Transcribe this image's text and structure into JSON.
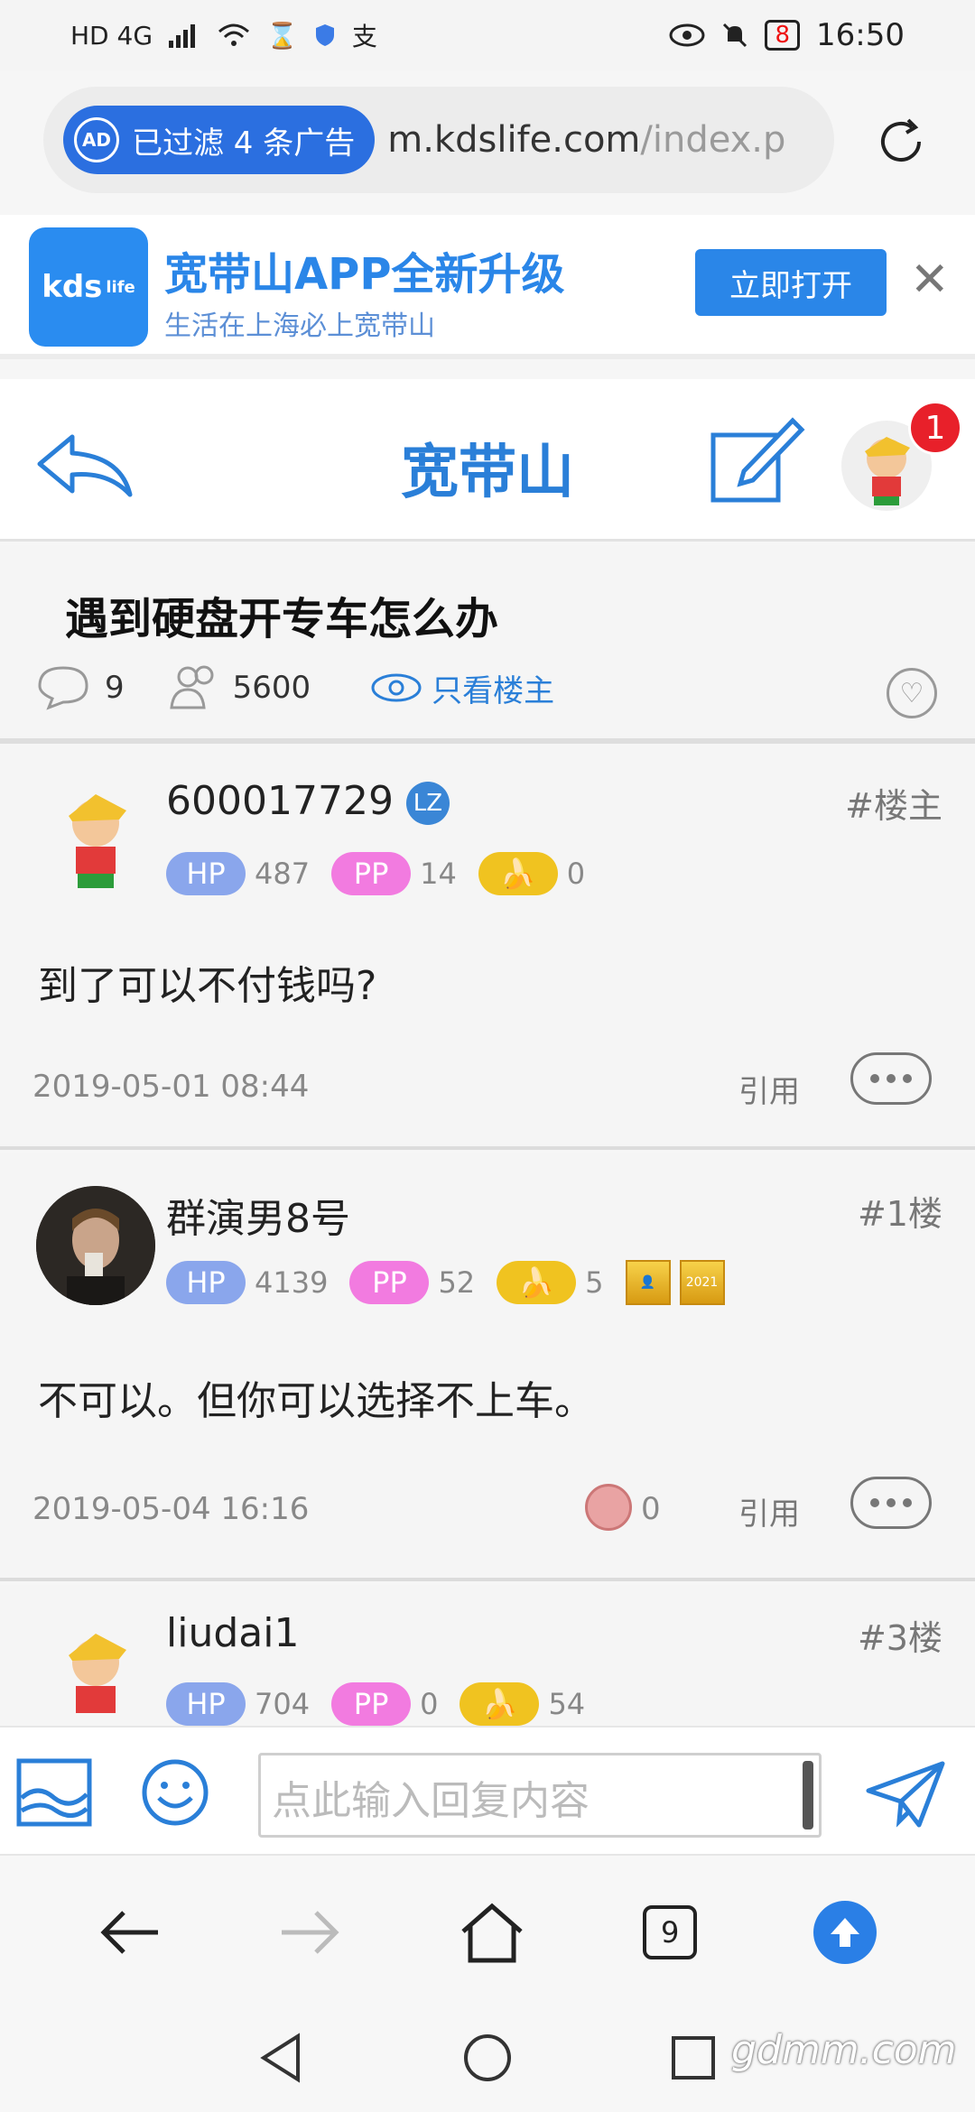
{
  "status_bar": {
    "left": "HD 4G",
    "battery": "8",
    "time": "16:50"
  },
  "url_bar": {
    "ad_filter": "已过滤 4 条广告",
    "ad_icon": "AD",
    "url_main": "m.kdslife.com",
    "url_rest": "/index.p"
  },
  "promo": {
    "logo_text": "kds",
    "logo_sub": "life",
    "title": "宽带山APP全新升级",
    "subtitle": "生活在上海必上宽带山",
    "open_button": "立即打开",
    "close": "✕"
  },
  "header": {
    "title": "宽带山",
    "notification_count": "1"
  },
  "thread": {
    "title": "遇到硬盘开专车怎么办",
    "comments": "9",
    "views": "5600",
    "only_op": "只看楼主"
  },
  "posts": [
    {
      "user": "600017729",
      "badge": "LZ",
      "floor": "#楼主",
      "hp_label": "HP",
      "hp": "487",
      "pp_label": "PP",
      "pp": "14",
      "banana": "0",
      "content": "到了可以不付钱吗?",
      "time": "2019-05-01 08:44",
      "quote": "引用"
    },
    {
      "user": "群演男8号",
      "floor": "#1楼",
      "hp_label": "HP",
      "hp": "4139",
      "pp_label": "PP",
      "pp": "52",
      "banana": "5",
      "medal": "2021",
      "content": "不可以。但你可以选择不上车。",
      "time": "2019-05-04 16:16",
      "likes": "0",
      "quote": "引用"
    },
    {
      "user": "liudai1",
      "floor": "#3楼",
      "hp_label": "HP",
      "hp": "704",
      "pp_label": "PP",
      "pp": "0",
      "banana": "54"
    }
  ],
  "reply_bar": {
    "placeholder": "点此输入回复内容"
  },
  "browser_nav": {
    "tab_count": "9"
  },
  "watermark": "gdmm.com",
  "colors": {
    "accent": "#2a7fd8",
    "hp": "#8aa6ec",
    "pp": "#f27be0",
    "banana": "#f0c320",
    "badge": "#e8202a"
  }
}
